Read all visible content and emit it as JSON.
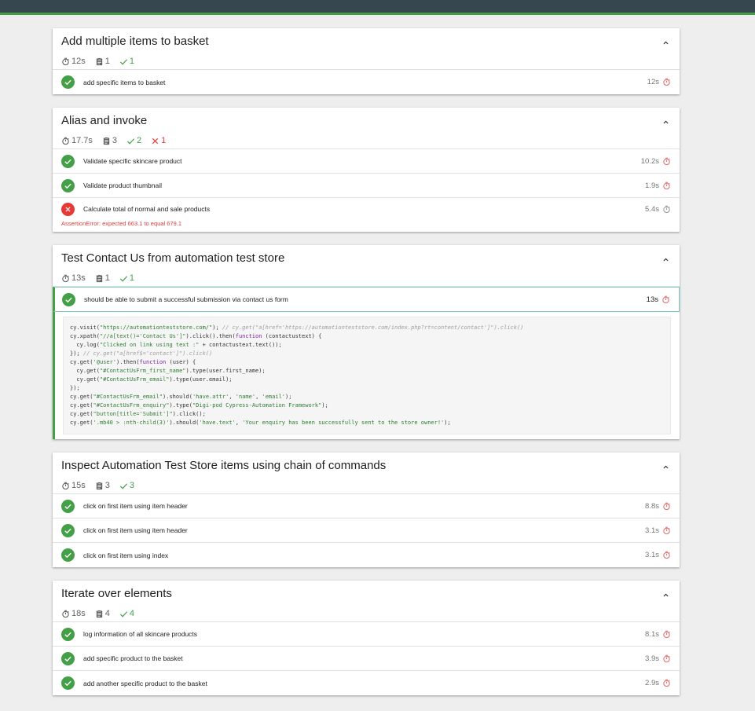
{
  "suites": [
    {
      "title": "Add multiple items to basket",
      "summary": {
        "duration": "12s",
        "tests": "1",
        "passed": "1",
        "failed": null
      },
      "tests": [
        {
          "title": "add specific items to basket",
          "time": "12s",
          "state": "passed",
          "timer_color": "#e57373"
        }
      ]
    },
    {
      "title": "Alias and invoke",
      "summary": {
        "duration": "17.7s",
        "tests": "3",
        "passed": "2",
        "failed": "1"
      },
      "tests": [
        {
          "title": "Validate specific skincare product",
          "time": "10.2s",
          "state": "passed",
          "timer_color": "#e57373"
        },
        {
          "title": "Validate product thumbnail",
          "time": "1.9s",
          "state": "passed",
          "timer_color": "#e57373"
        },
        {
          "title": "Calculate total of normal and sale products",
          "time": "5.4s",
          "state": "failed",
          "timer_color": "#9e9e9e",
          "error": "AssertionError: expected 663.1 to equal 679.1"
        }
      ]
    },
    {
      "title": "Test Contact Us from automation test store",
      "summary": {
        "duration": "13s",
        "tests": "1",
        "passed": "1",
        "failed": null
      },
      "tests": [
        {
          "title": "should be able to submit a successful submission via contact us form",
          "time": "13s",
          "state": "passed",
          "timer_color": "#e57373",
          "expanded": true
        }
      ]
    },
    {
      "title": "Inspect Automation Test Store items using chain of commands",
      "summary": {
        "duration": "15s",
        "tests": "3",
        "passed": "3",
        "failed": null
      },
      "tests": [
        {
          "title": "click on first item using item header",
          "time": "8.8s",
          "state": "passed",
          "timer_color": "#e57373"
        },
        {
          "title": "click on first item using item header",
          "time": "3.1s",
          "state": "passed",
          "timer_color": "#e57373"
        },
        {
          "title": "click on first item using index",
          "time": "3.1s",
          "state": "passed",
          "timer_color": "#e57373"
        }
      ]
    },
    {
      "title": "Iterate over elements",
      "summary": {
        "duration": "18s",
        "tests": "4",
        "passed": "4",
        "failed": null
      },
      "tests": [
        {
          "title": "log information of all skincare products",
          "time": "8.1s",
          "state": "passed",
          "timer_color": "#e57373"
        },
        {
          "title": "add specific product to the basket",
          "time": "3.9s",
          "state": "passed",
          "timer_color": "#e57373"
        },
        {
          "title": "add another specific product to the basket",
          "time": "2.9s",
          "state": "passed",
          "timer_color": "#e57373"
        }
      ]
    }
  ],
  "code": [
    [
      [
        "n",
        "cy.visit("
      ],
      [
        "s",
        "\"https://automationteststore.com/\""
      ],
      [
        "n",
        "); "
      ],
      [
        "c",
        "// cy.get(\"a[href='https://automationteststore.com/index.php?rt=content/contact']\").click()"
      ]
    ],
    [
      [
        "n",
        "cy.xpath("
      ],
      [
        "s",
        "\"//a[text()='Contact Us']\""
      ],
      [
        "n",
        ").click().then("
      ],
      [
        "k",
        "function"
      ],
      [
        "n",
        " (contactustext) {"
      ]
    ],
    [
      [
        "n",
        "  cy.log("
      ],
      [
        "s",
        "\"Clicked on link using text :\""
      ],
      [
        "n",
        " + contactustext.text());"
      ]
    ],
    [
      [
        "n",
        "}); "
      ],
      [
        "c",
        "// cy.get(\"a[href$='contact']\").click()"
      ]
    ],
    [
      [
        "n",
        "cy.get("
      ],
      [
        "s",
        "'@user'"
      ],
      [
        "n",
        ").then("
      ],
      [
        "k",
        "function"
      ],
      [
        "n",
        " (user) {"
      ]
    ],
    [
      [
        "n",
        "  cy.get("
      ],
      [
        "s",
        "\"#ContactUsFrm_first_name\""
      ],
      [
        "n",
        ").type(user.first_name);"
      ]
    ],
    [
      [
        "n",
        "  cy.get("
      ],
      [
        "s",
        "\"#ContactUsFrm_email\""
      ],
      [
        "n",
        ").type(user.email);"
      ]
    ],
    [
      [
        "n",
        "});"
      ]
    ],
    [
      [
        "n",
        "cy.get("
      ],
      [
        "s",
        "\"#ContactUsFrm_email\""
      ],
      [
        "n",
        ").should("
      ],
      [
        "s",
        "'have.attr'"
      ],
      [
        "n",
        ", "
      ],
      [
        "s",
        "'name'"
      ],
      [
        "n",
        ", "
      ],
      [
        "s",
        "'email'"
      ],
      [
        "n",
        ");"
      ]
    ],
    [
      [
        "n",
        "cy.get("
      ],
      [
        "s",
        "\"#ContactUsFrm_enquiry\""
      ],
      [
        "n",
        ").type("
      ],
      [
        "s",
        "\"Digi-pod Cypress-Automation Framework\""
      ],
      [
        "n",
        ");"
      ]
    ],
    [
      [
        "n",
        "cy.get("
      ],
      [
        "s",
        "\"button[title='Submit']\""
      ],
      [
        "n",
        ").click();"
      ]
    ],
    [
      [
        "n",
        "cy.get("
      ],
      [
        "s",
        "'.mb40 > :nth-child(3)'"
      ],
      [
        "n",
        ").should("
      ],
      [
        "s",
        "'have.text'"
      ],
      [
        "n",
        ", "
      ],
      [
        "s",
        "'Your enquiry has been successfully sent to the store owner!'"
      ],
      [
        "n",
        ");"
      ]
    ]
  ]
}
